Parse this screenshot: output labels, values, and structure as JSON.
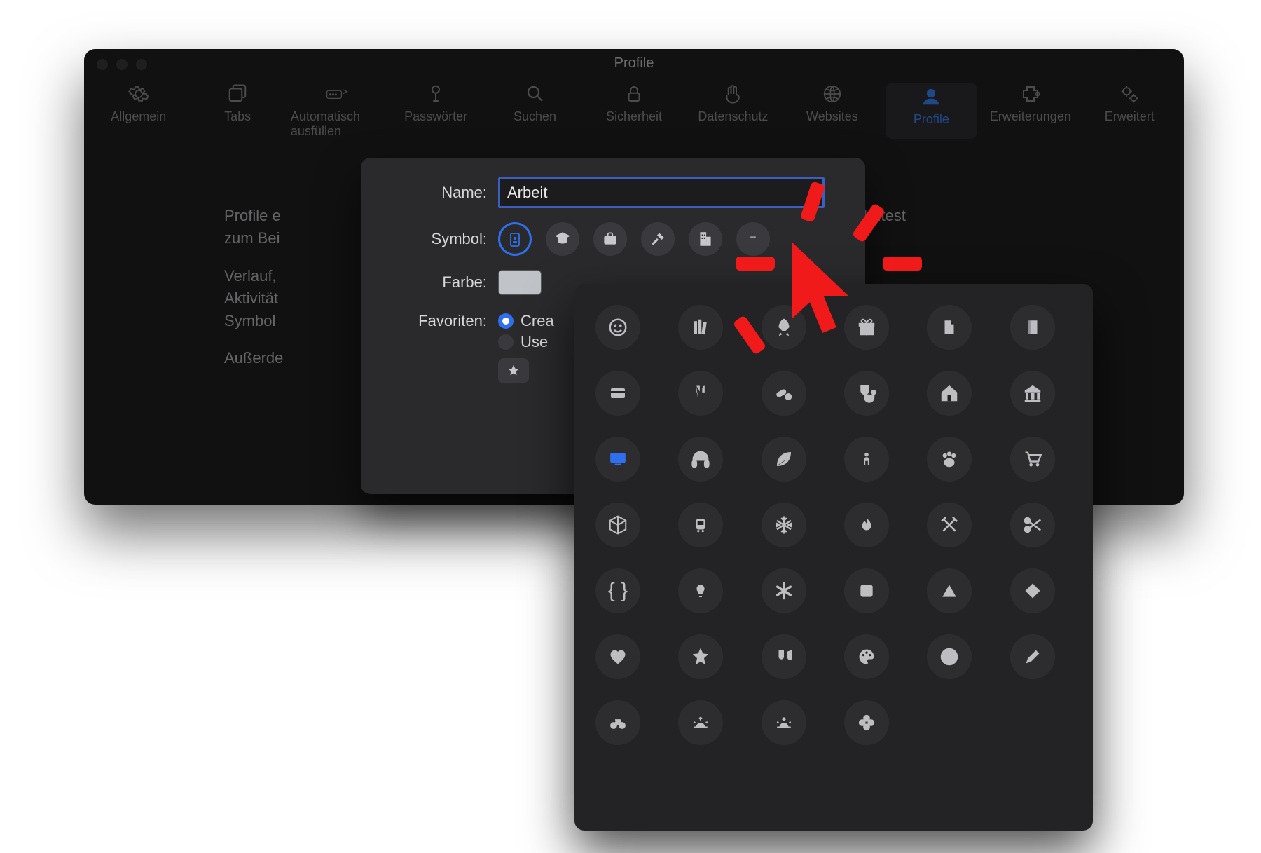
{
  "window": {
    "title": "Profile",
    "tabs": [
      {
        "id": "general",
        "label": "Allgemein"
      },
      {
        "id": "tabs",
        "label": "Tabs"
      },
      {
        "id": "autofill",
        "label": "Automatisch ausfüllen"
      },
      {
        "id": "passwords",
        "label": "Passwörter"
      },
      {
        "id": "search",
        "label": "Suchen"
      },
      {
        "id": "security",
        "label": "Sicherheit"
      },
      {
        "id": "privacy",
        "label": "Datenschutz"
      },
      {
        "id": "websites",
        "label": "Websites"
      },
      {
        "id": "profiles",
        "label": "Profile",
        "selected": true
      },
      {
        "id": "extensions",
        "label": "Erweiterungen"
      },
      {
        "id": "advanced",
        "label": "Erweitert"
      }
    ],
    "body": {
      "line1": "Profile e",
      "line1_suffix": "hntest",
      "line2": "zum Bei",
      "line3": "Verlauf,",
      "line4": "Aktivität",
      "line5": "Symbol",
      "line6": "Außerde"
    }
  },
  "sheet": {
    "labels": {
      "name": "Name:",
      "symbol": "Symbol:",
      "color": "Farbe:",
      "favorites": "Favoriten:"
    },
    "name_value": "Arbeit",
    "color_hex": "#c0c4c8",
    "symbols": [
      {
        "id": "id-card",
        "selected": true
      },
      {
        "id": "graduation-cap"
      },
      {
        "id": "briefcase"
      },
      {
        "id": "hammer"
      },
      {
        "id": "building"
      },
      {
        "id": "more"
      }
    ],
    "favorites": {
      "create_label": "Crea",
      "use_label": "Use",
      "selected": "create"
    }
  },
  "popover": {
    "icons": [
      "smiley",
      "books",
      "rocket",
      "gift",
      "document",
      "book",
      "credit-card",
      "fork-knife",
      "pills",
      "stethoscope",
      "house",
      "bank",
      "display",
      "headphones",
      "leaf",
      "person",
      "pawprint",
      "cart",
      "cube",
      "tram",
      "snowflake",
      "flame",
      "tools",
      "scissors",
      "braces",
      "lightbulb",
      "asterisk",
      "square",
      "triangle",
      "diamond",
      "heart",
      "star",
      "guitars",
      "palette",
      "globe",
      "pencil",
      "bicycle",
      "sunrise",
      "sunset",
      "flower"
    ],
    "selected": "display"
  }
}
